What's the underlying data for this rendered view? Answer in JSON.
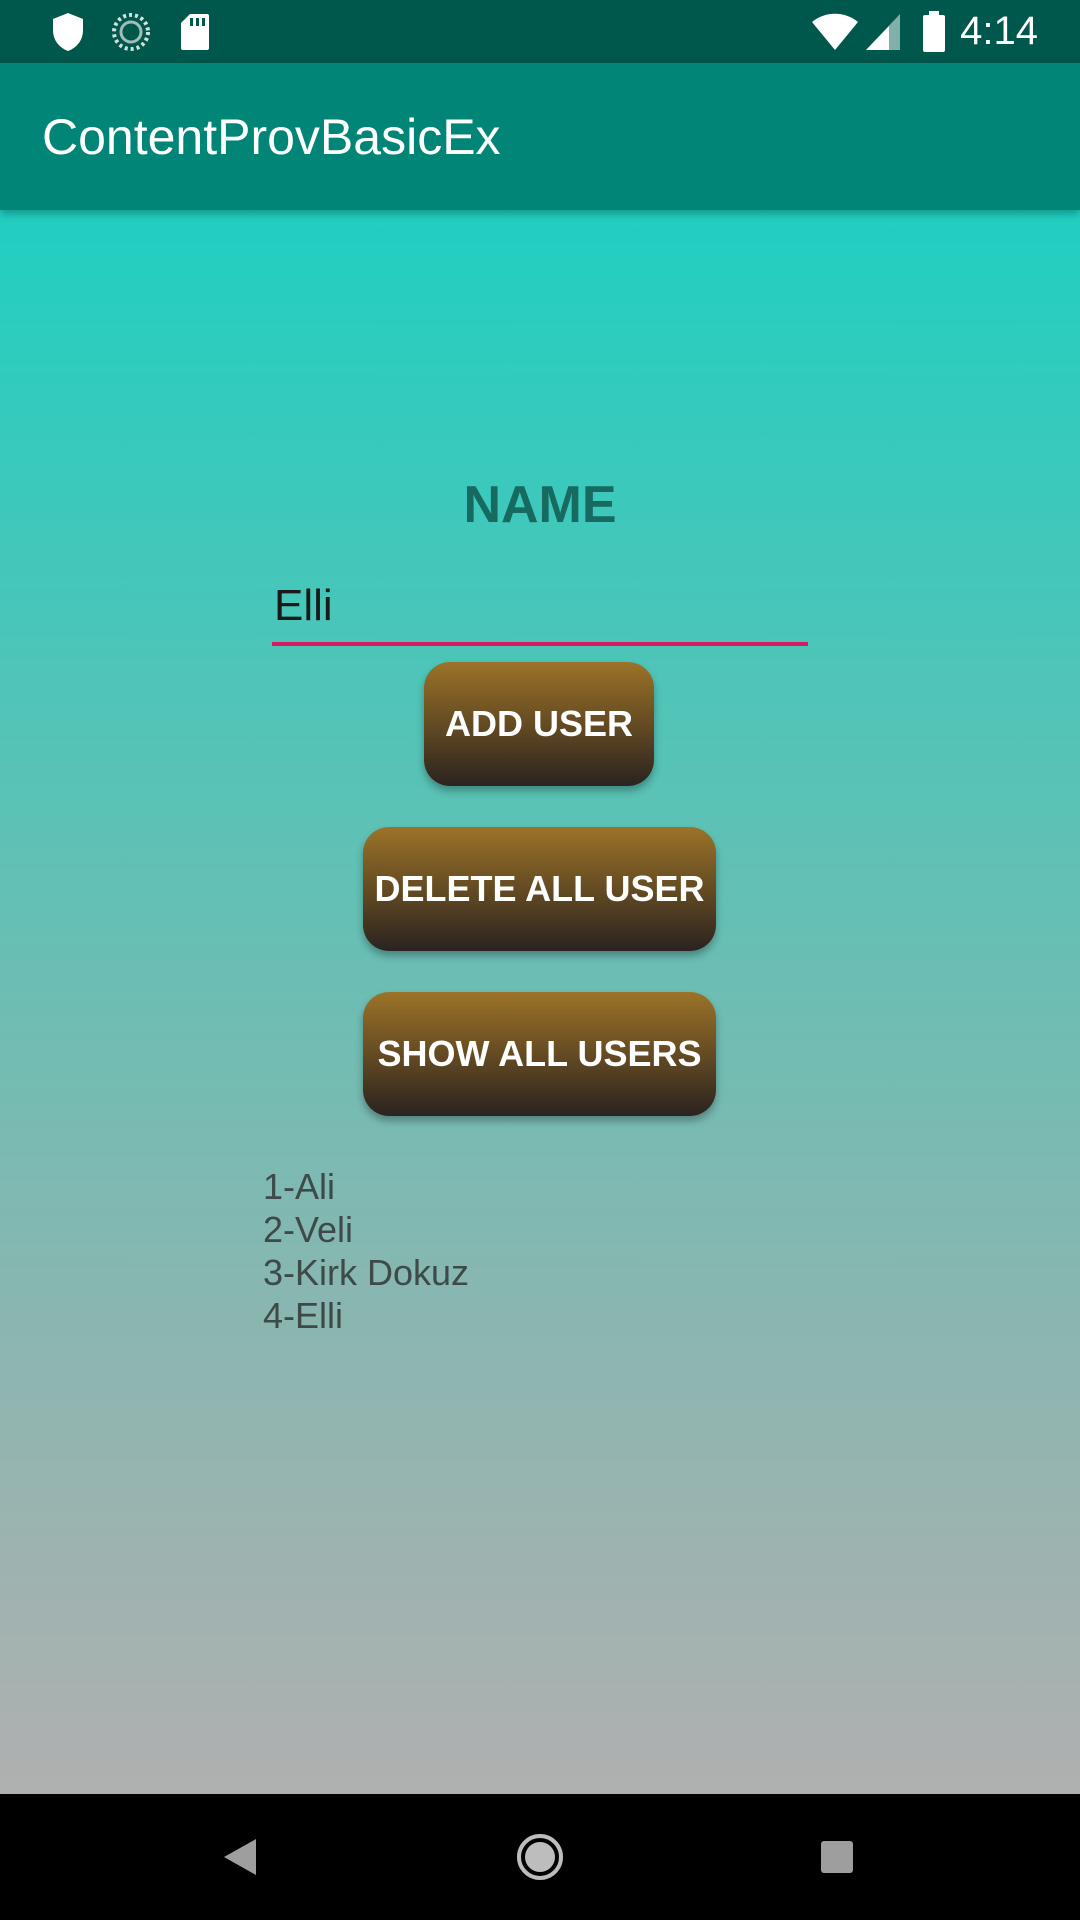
{
  "status_bar": {
    "time": "4:14",
    "icons": [
      "shield-icon",
      "sync-icon",
      "sd-card-icon",
      "wifi-icon",
      "signal-icon",
      "battery-icon"
    ]
  },
  "app_bar": {
    "title": "ContentProvBasicEx",
    "color": "#008577"
  },
  "form": {
    "label": "NAME",
    "name_value": "Elli",
    "underline_color": "#d81b60"
  },
  "buttons": {
    "add": "ADD USER",
    "delete_all": "DELETE ALL USER",
    "show_all": "SHOW ALL USERS"
  },
  "users": [
    "1-Ali",
    "2-Veli",
    "3-Kirk Dokuz",
    "4-Elli"
  ],
  "nav_bar": {
    "icons": [
      "back-icon",
      "home-icon",
      "recents-icon"
    ]
  }
}
